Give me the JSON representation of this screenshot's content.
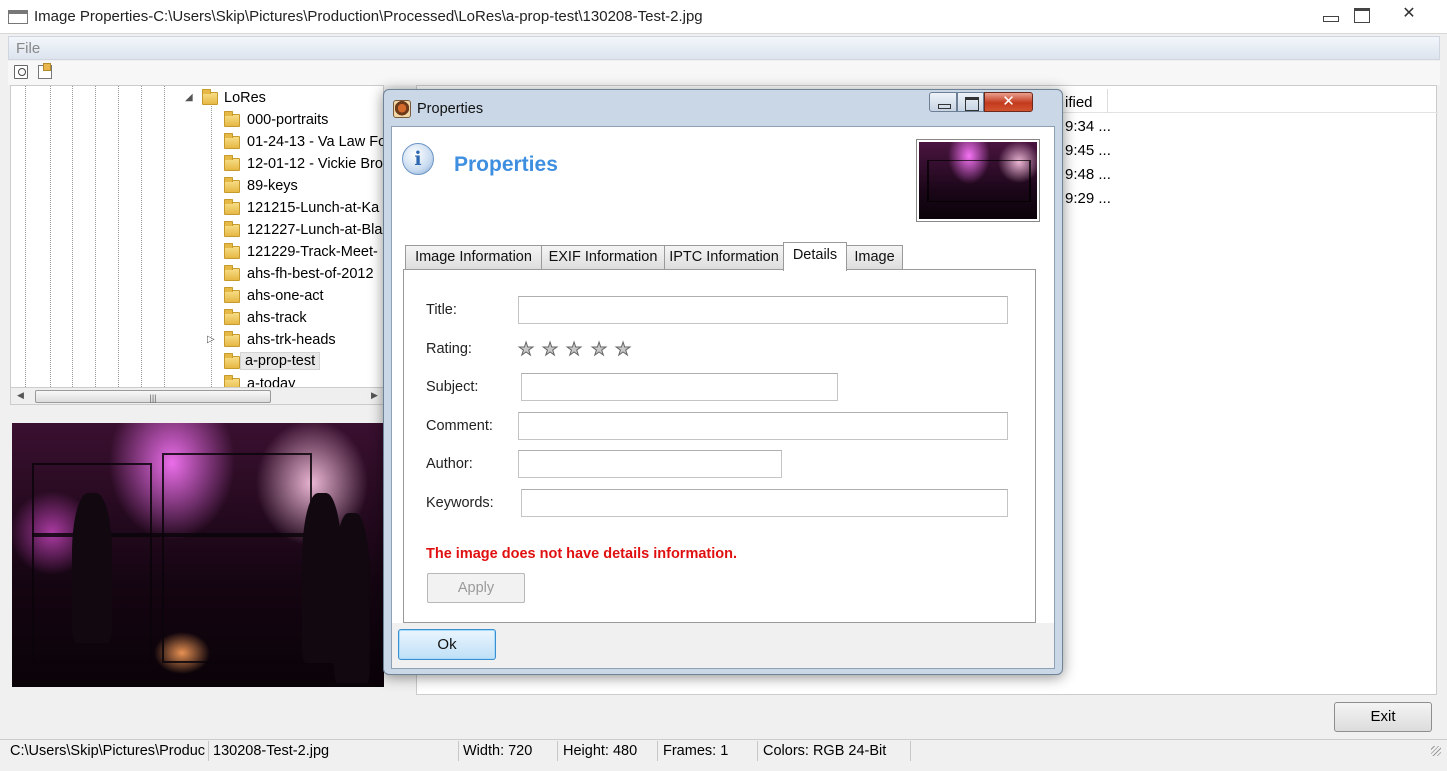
{
  "main_window": {
    "title": "Image Properties-C:\\Users\\Skip\\Pictures\\Production\\Processed\\LoRes\\a-prop-test\\130208-Test-2.jpg",
    "menu": {
      "file_label": "File"
    },
    "exit_label": "Exit"
  },
  "tree": {
    "root_label": "LoRes",
    "items": [
      {
        "label": "000-portraits"
      },
      {
        "label": "01-24-13 - Va Law Fo"
      },
      {
        "label": "12-01-12 - Vickie Bro"
      },
      {
        "label": "89-keys"
      },
      {
        "label": "121215-Lunch-at-Ka"
      },
      {
        "label": "121227-Lunch-at-Bla"
      },
      {
        "label": "121229-Track-Meet-"
      },
      {
        "label": "ahs-fh-best-of-2012"
      },
      {
        "label": "ahs-one-act"
      },
      {
        "label": "ahs-track"
      },
      {
        "label": "ahs-trk-heads"
      },
      {
        "label": "a-prop-test"
      },
      {
        "label": "a-today"
      }
    ]
  },
  "list": {
    "modified_header": "ified",
    "rows": [
      "9:34 ...",
      "9:45 ...",
      "9:48 ...",
      "9:29 ..."
    ]
  },
  "statusbar": {
    "path": "C:\\Users\\Skip\\Pictures\\Produc",
    "file": "130208-Test-2.jpg",
    "width": "Width: 720",
    "height": "Height: 480",
    "frames": "Frames: 1",
    "colors": "Colors: RGB 24-Bit"
  },
  "dialog": {
    "title": "Properties",
    "heading": "Properties",
    "tabs": [
      {
        "label": "Image Information"
      },
      {
        "label": "EXIF Information"
      },
      {
        "label": "IPTC Information"
      },
      {
        "label": "Details"
      },
      {
        "label": "Image"
      }
    ],
    "active_tab": "Details",
    "fields": {
      "title_label": "Title:",
      "rating_label": "Rating:",
      "rating_value": 0,
      "rating_max": 5,
      "subject_label": "Subject:",
      "comment_label": "Comment:",
      "author_label": "Author:",
      "keywords_label": "Keywords:"
    },
    "message": "The image does not have details information.",
    "apply_label": "Apply",
    "ok_label": "Ok"
  },
  "colors": {
    "heading_blue": "#3f8fe0",
    "error_red": "#e01010"
  }
}
